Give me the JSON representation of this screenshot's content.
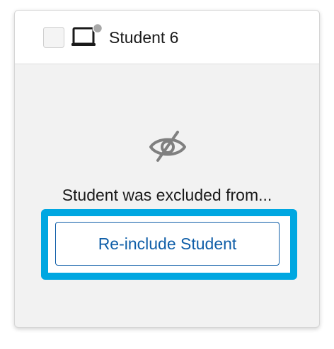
{
  "student": {
    "name": "Student 6",
    "checkbox_checked": false,
    "device_icon": "laptop-icon",
    "status_dot_color": "#a8a8a8"
  },
  "status": {
    "icon": "eye-slash-icon",
    "message": "Student was excluded from..."
  },
  "actions": {
    "reinclude_label": "Re-include Student"
  },
  "colors": {
    "accent": "#0f5ea8",
    "focus_ring": "#00a7e1",
    "card_background": "#f2f2f2"
  }
}
